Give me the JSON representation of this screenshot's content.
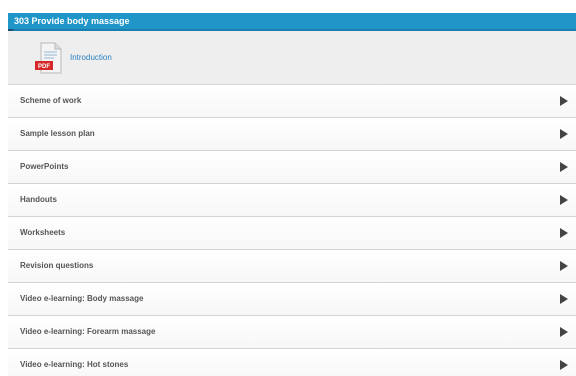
{
  "header": {
    "title": "303 Provide body massage"
  },
  "intro": {
    "link_label": "Introduction",
    "file_badge": "PDF"
  },
  "list": {
    "items": [
      {
        "label": "Scheme of work"
      },
      {
        "label": "Sample lesson plan"
      },
      {
        "label": "PowerPoints"
      },
      {
        "label": "Handouts"
      },
      {
        "label": "Worksheets"
      },
      {
        "label": "Revision questions"
      },
      {
        "label": "Video e-learning: Body massage"
      },
      {
        "label": "Video e-learning: Forearm massage"
      },
      {
        "label": "Video e-learning: Hot stones"
      }
    ]
  },
  "colors": {
    "header_bg": "#1f95c8",
    "link": "#2a7fbf",
    "pdf_badge": "#d62828"
  },
  "icons": {
    "intro": "pdf-file-icon",
    "list_item": "chevron-right-icon"
  }
}
